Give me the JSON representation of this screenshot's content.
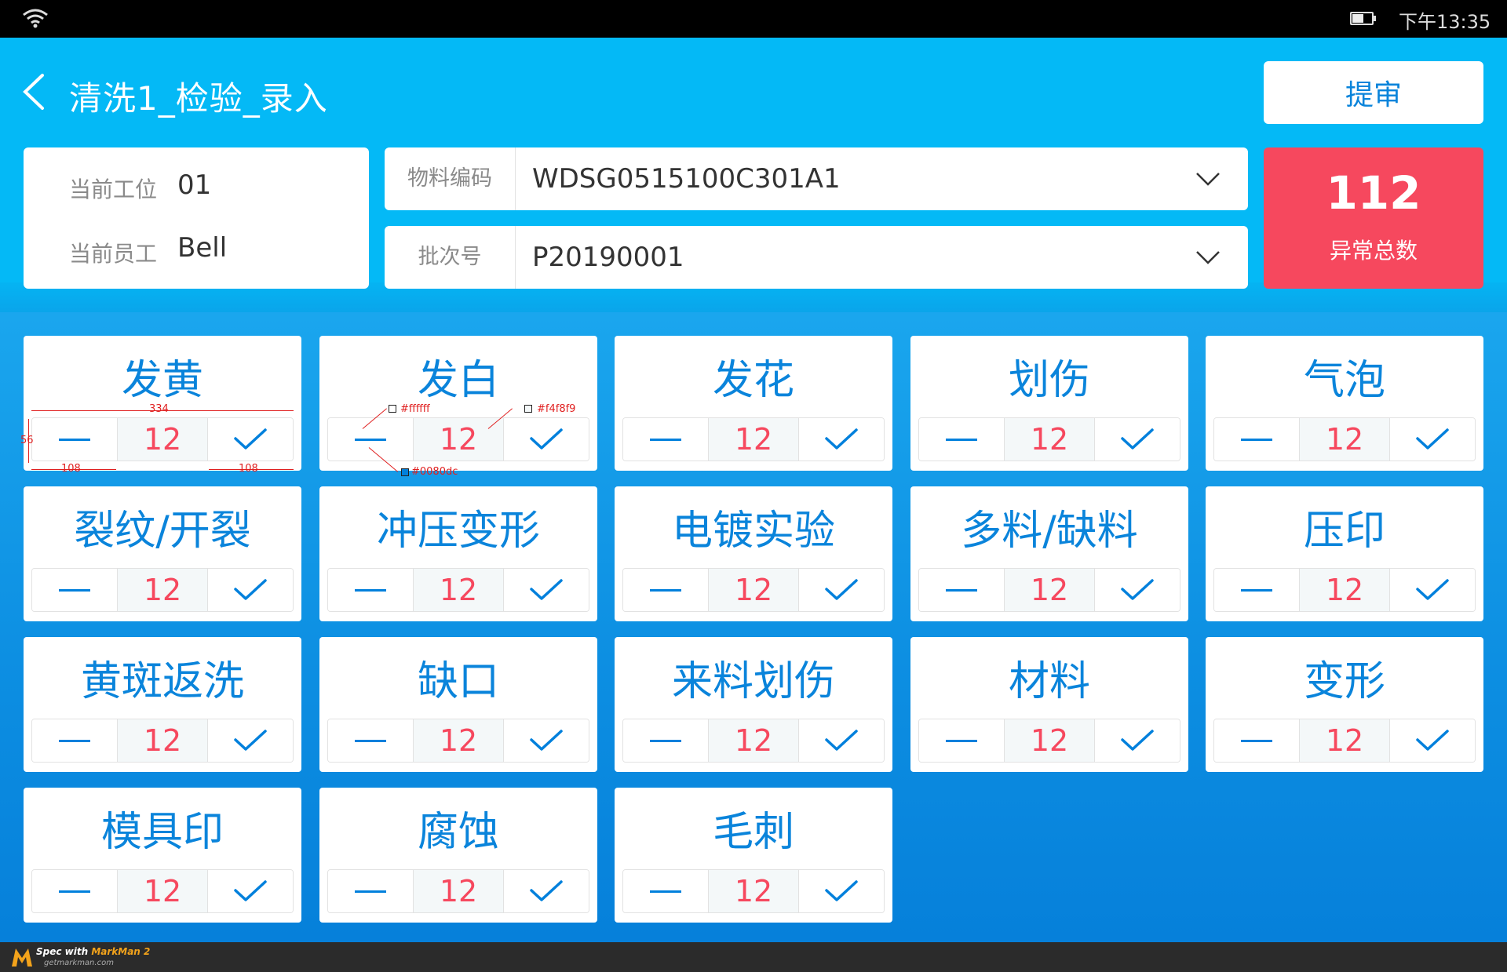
{
  "status_bar": {
    "time": "下午13:35",
    "wifi_icon": "wifi-icon",
    "battery_icon": "battery-icon"
  },
  "header": {
    "title": "清洗1_检验_录入",
    "back_icon": "chevron-left-icon",
    "submit_label": "提审"
  },
  "info": {
    "station_label": "当前工位",
    "station_value": "01",
    "staff_label": "当前员工",
    "staff_value": "Bell"
  },
  "selects": {
    "material": {
      "label": "物料编码",
      "value": "WDSG0515100C301A1"
    },
    "batch": {
      "label": "批次号",
      "value": "P20190001"
    }
  },
  "summary": {
    "total": "112",
    "label": "异常总数",
    "color": "#f6485e"
  },
  "colors": {
    "accent": "#0080dc",
    "header_bg": "#04b9f6",
    "count_bg": "#f4f8f9",
    "count_text": "#f6485e"
  },
  "defects": [
    {
      "name": "发黄",
      "count": "12"
    },
    {
      "name": "发白",
      "count": "12"
    },
    {
      "name": "发花",
      "count": "12"
    },
    {
      "name": "划伤",
      "count": "12"
    },
    {
      "name": "气泡",
      "count": "12"
    },
    {
      "name": "裂纹/开裂",
      "count": "12"
    },
    {
      "name": "冲压变形",
      "count": "12"
    },
    {
      "name": "电镀实验",
      "count": "12"
    },
    {
      "name": "多料/缺料",
      "count": "12"
    },
    {
      "name": "压印",
      "count": "12"
    },
    {
      "name": "黄斑返洗",
      "count": "12"
    },
    {
      "name": "缺口",
      "count": "12"
    },
    {
      "name": "来料划伤",
      "count": "12"
    },
    {
      "name": "材料",
      "count": "12"
    },
    {
      "name": "变形",
      "count": "12"
    },
    {
      "name": "模具印",
      "count": "12"
    },
    {
      "name": "腐蚀",
      "count": "12"
    },
    {
      "name": "毛刺",
      "count": "12"
    }
  ],
  "annotations": {
    "width": "334",
    "height": "56",
    "left_width": "108",
    "right_width": "108",
    "color_white": "#ffffff",
    "color_gray": "#f4f8f9",
    "color_blue": "#0080dc"
  },
  "footer": {
    "prefix": "Spec with ",
    "brand": "MarkMan 2",
    "url": "getmarkman.com"
  }
}
